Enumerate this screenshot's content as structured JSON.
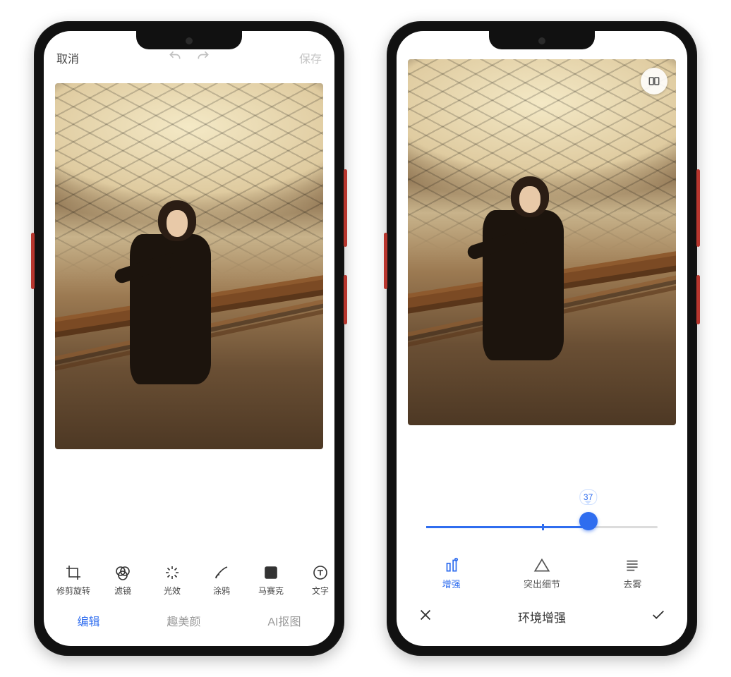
{
  "colors": {
    "accent": "#2f6def"
  },
  "left": {
    "topbar": {
      "cancel": "取消",
      "undo_icon": "undo-icon",
      "redo_icon": "redo-icon",
      "save": "保存"
    },
    "tools": [
      {
        "id": "crop-rotate",
        "label": "修剪旋转",
        "icon": "crop-icon"
      },
      {
        "id": "filter",
        "label": "滤镜",
        "icon": "filter-icon"
      },
      {
        "id": "light-fx",
        "label": "光效",
        "icon": "sparkle-icon"
      },
      {
        "id": "doodle",
        "label": "涂鸦",
        "icon": "brush-icon"
      },
      {
        "id": "mosaic",
        "label": "马赛克",
        "icon": "mosaic-icon"
      },
      {
        "id": "text",
        "label": "文字",
        "icon": "text-icon"
      }
    ],
    "tabs": [
      {
        "id": "edit",
        "label": "编辑",
        "active": true
      },
      {
        "id": "beauty",
        "label": "趣美颜",
        "active": false
      },
      {
        "id": "ai-cut",
        "label": "AI抠图",
        "active": false
      }
    ]
  },
  "right": {
    "slider": {
      "value": 37,
      "min": 0,
      "max": 100,
      "mid": 50,
      "fill_percent": 70,
      "thumb_percent": 70
    },
    "compare_icon": "compare-icon",
    "options": [
      {
        "id": "enhance",
        "label": "增强",
        "icon": "enhance-icon",
        "active": true
      },
      {
        "id": "detail",
        "label": "突出细节",
        "icon": "triangle-icon",
        "active": false
      },
      {
        "id": "dehaze",
        "label": "去雾",
        "icon": "lines-icon",
        "active": false
      }
    ],
    "panel_title": "环境增强",
    "close_icon": "close-icon",
    "confirm_icon": "check-icon"
  }
}
